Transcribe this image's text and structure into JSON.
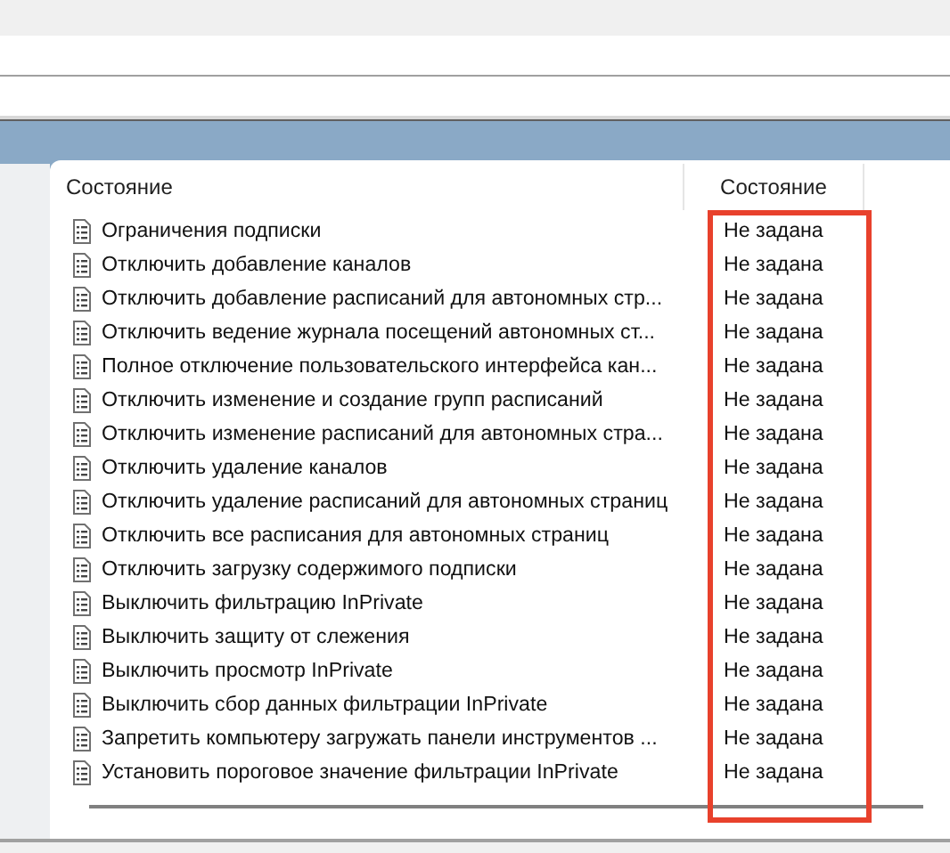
{
  "table": {
    "columns": [
      "Состояние",
      "Состояние"
    ],
    "rows": [
      {
        "name": "Ограничения подписки",
        "state": "Не задана"
      },
      {
        "name": "Отключить добавление каналов",
        "state": "Не задана"
      },
      {
        "name": "Отключить добавление расписаний для автономных стр...",
        "state": "Не задана"
      },
      {
        "name": "Отключить ведение журнала посещений автономных ст...",
        "state": "Не задана"
      },
      {
        "name": "Полное отключение пользовательского интерфейса кан...",
        "state": "Не задана"
      },
      {
        "name": "Отключить изменение и создание групп расписаний",
        "state": "Не задана"
      },
      {
        "name": "Отключить изменение расписаний для автономных стра...",
        "state": "Не задана"
      },
      {
        "name": "Отключить удаление каналов",
        "state": "Не задана"
      },
      {
        "name": "Отключить удаление расписаний для автономных страниц",
        "state": "Не задана"
      },
      {
        "name": "Отключить все расписания для автономных страниц",
        "state": "Не задана"
      },
      {
        "name": "Отключить загрузку содержимого подписки",
        "state": "Не задана"
      },
      {
        "name": "Выключить фильтрацию InPrivate",
        "state": "Не задана"
      },
      {
        "name": "Выключить защиту от слежения",
        "state": "Не задана"
      },
      {
        "name": "Выключить просмотр InPrivate",
        "state": "Не задана"
      },
      {
        "name": "Выключить сбор данных фильтрации InPrivate",
        "state": "Не задана"
      },
      {
        "name": "Запретить компьютеру загружать панели инструментов ...",
        "state": "Не задана"
      },
      {
        "name": "Установить пороговое значение фильтрации InPrivate",
        "state": "Не задана"
      }
    ]
  }
}
